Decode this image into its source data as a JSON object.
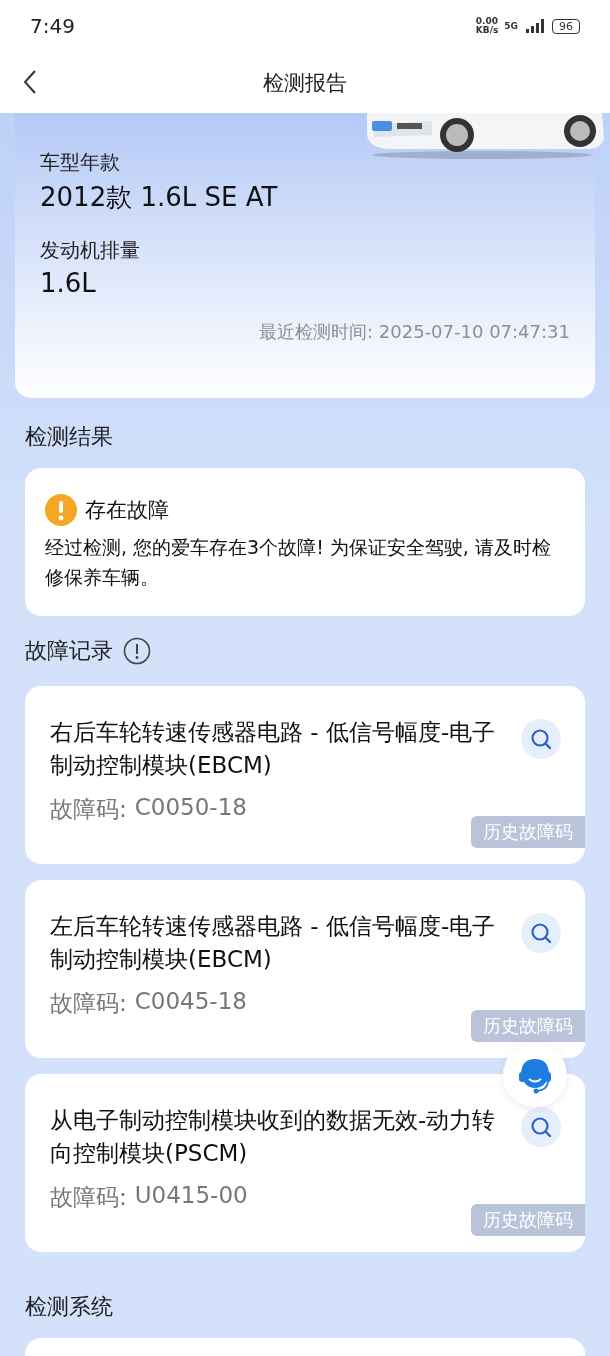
{
  "status_bar": {
    "time": "7:49",
    "net_speed": "0.00",
    "net_unit": "KB/s",
    "network": "5G",
    "battery": "96"
  },
  "header": {
    "title": "检测报告"
  },
  "vehicle": {
    "fields": [
      {
        "label": "车型年款",
        "value": "2012款 1.6L SE AT"
      },
      {
        "label": "发动机排量",
        "value": "1.6L"
      }
    ],
    "last_check": "最近检测时间: 2025-07-10 07:47:31"
  },
  "result": {
    "heading": "检测结果",
    "title": "存在故障",
    "message": "经过检测, 您的爱车存在3个故障! 为保证安全驾驶, 请及时检修保养车辆。"
  },
  "faults": {
    "heading": "故障记录",
    "items": [
      {
        "description": "右后车轮转速传感器电路 - 低信号幅度-电子制动控制模块(EBCM)",
        "code_label": "故障码:",
        "code": "C0050-18",
        "badge": "历史故障码"
      },
      {
        "description": "左后车轮转速传感器电路 - 低信号幅度-电子制动控制模块(EBCM)",
        "code_label": "故障码:",
        "code": "C0045-18",
        "badge": "历史故障码"
      },
      {
        "description": "从电子制动控制模块收到的数据无效-动力转向控制模块(PSCM)",
        "code_label": "故障码:",
        "code": "U0415-00",
        "badge": "历史故障码"
      }
    ]
  },
  "systems": {
    "heading": "检测系统"
  }
}
